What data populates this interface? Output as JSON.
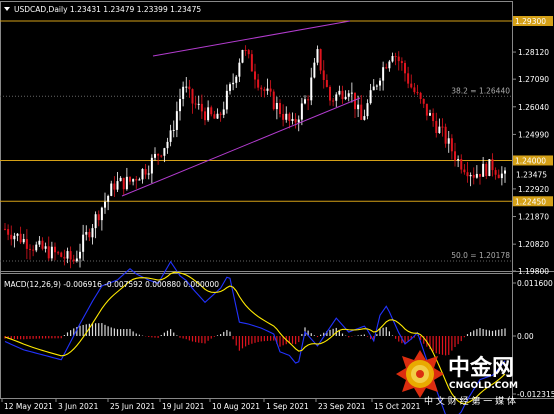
{
  "main_chart": {
    "title": "USDCAD,Daily  1.23431 1.23479 1.23399 1.23475",
    "price_axis": [
      "1.29300",
      "1.28120",
      "1.27090",
      "1.26040",
      "1.24990",
      "1.23940",
      "1.22920",
      "1.21870",
      "1.20820",
      "1.19800"
    ],
    "highlighted_levels": [
      {
        "label": "1.29300",
        "value": 1.293,
        "color": "#d4a017"
      },
      {
        "label": "1.24000",
        "value": 1.24,
        "color": "#d4a017"
      },
      {
        "label": "1.22450",
        "value": 1.2245,
        "color": "#d4a017"
      }
    ],
    "current_price": {
      "label": "1.23475",
      "value": 1.23475
    },
    "fib_levels": [
      {
        "label": "38.2 = 1.26440",
        "value": 1.2644
      },
      {
        "label": "50.0 = 1.20178",
        "value": 1.20178
      }
    ],
    "colors": {
      "up": "#ffffff",
      "down": "#e0141e",
      "channel": "#b33ccf",
      "fib": "#666666"
    }
  },
  "macd_panel": {
    "title": "MACD(12,26,9) -0.006916 -0.007592 0.000880 0.000000",
    "axis": [
      "0.011600",
      "0.00",
      "-0.012315"
    ],
    "colors": {
      "macd_line": "#2233ff",
      "signal_line": "#ffea00"
    }
  },
  "time_axis": [
    "12 May 2021",
    "3 Jun 2021",
    "25 Jun 2021",
    "19 Jul 2021",
    "10 Aug 2021",
    "1 Sep 2021",
    "23 Sep 2021",
    "15 Oct 2021"
  ],
  "watermark": {
    "brand": "中金网",
    "site": "CNGOLD.COM",
    "slogan": "中 文 财 经 第 一 媒 体"
  }
}
